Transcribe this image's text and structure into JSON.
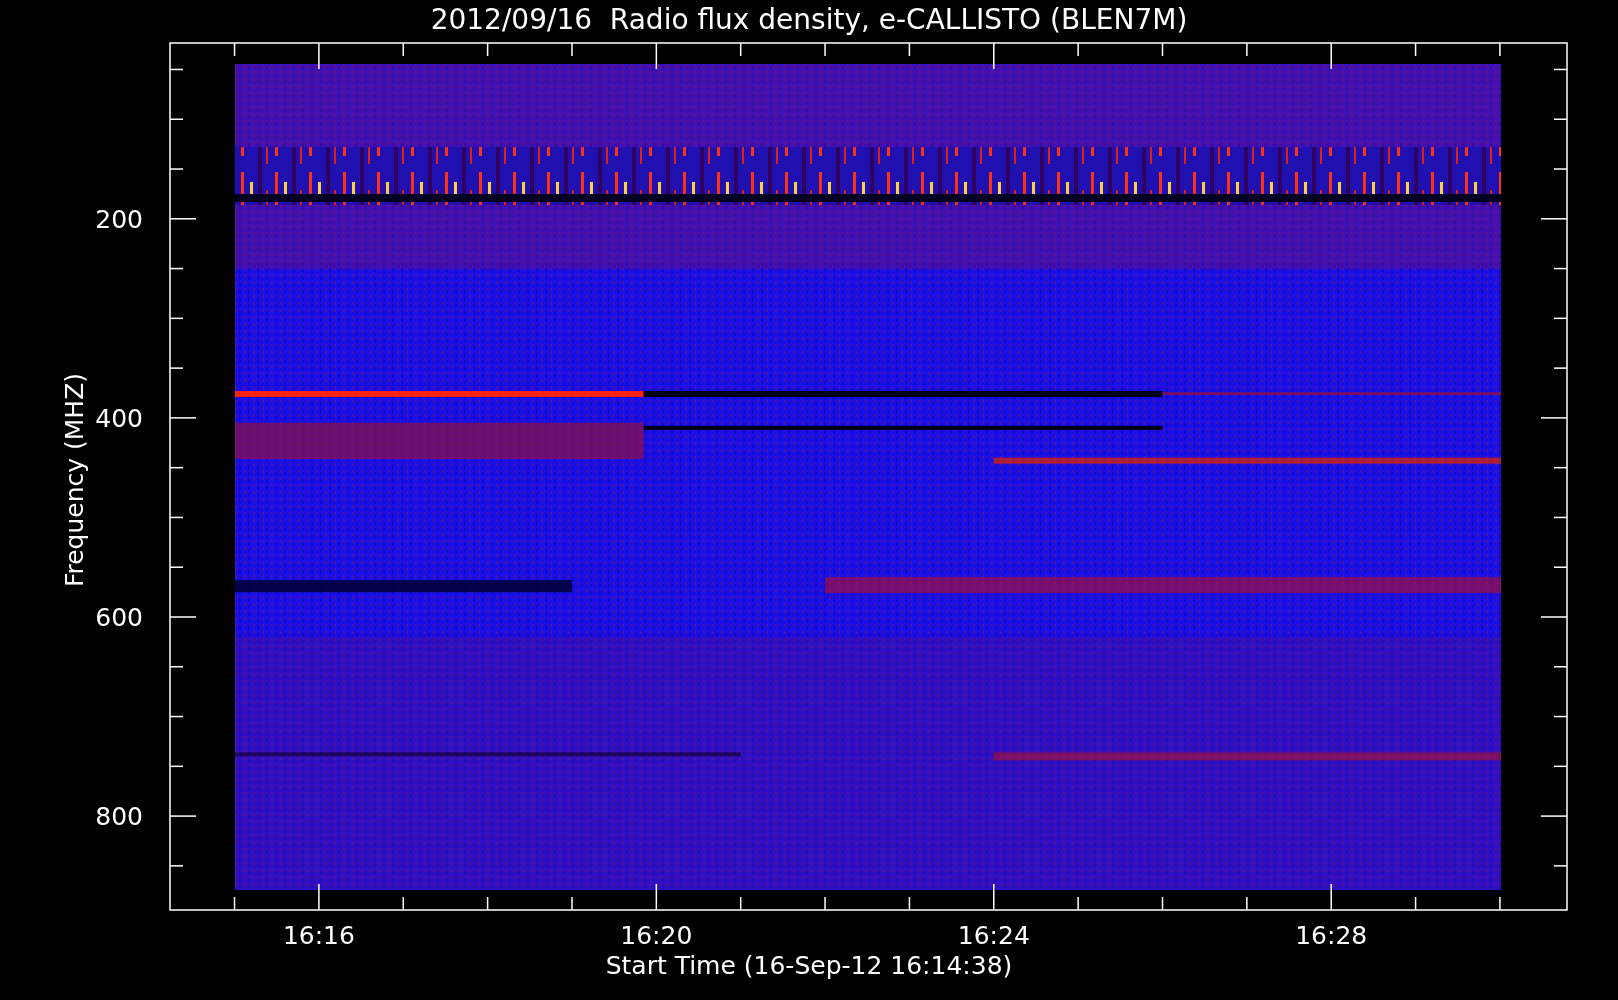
{
  "title": "2012/09/16  Radio flux density, e-CALLISTO (BLEN7M)",
  "y_axis": {
    "label": "Frequency (MHZ)",
    "ticks": [
      "200",
      "400",
      "600",
      "800"
    ]
  },
  "x_axis": {
    "label": "Start Time (16-Sep-12 16:14:38)",
    "ticks": [
      "16:16",
      "16:20",
      "16:24",
      "16:28"
    ]
  }
}
